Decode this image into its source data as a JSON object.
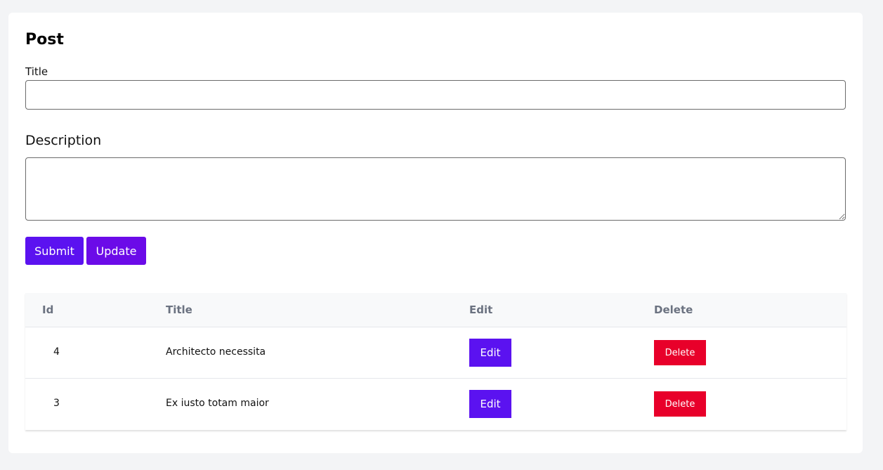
{
  "form": {
    "heading": "Post",
    "title_label": "Title",
    "title_value": "",
    "title_placeholder": "",
    "description_label": "Description",
    "description_value": "",
    "description_placeholder": "",
    "submit_label": "Submit",
    "update_label": "Update"
  },
  "table": {
    "columns": [
      "Id",
      "Title",
      "Edit",
      "Delete"
    ],
    "rows": [
      {
        "id": "4",
        "title": "Architecto necessita",
        "edit_label": "Edit",
        "delete_label": "Delete"
      },
      {
        "id": "3",
        "title": "Ex iusto totam maior",
        "edit_label": "Edit",
        "delete_label": "Delete"
      }
    ]
  },
  "colors": {
    "background": "#f3f4f6",
    "primary": "#5b12f0",
    "update": "#6b0be8",
    "danger": "#e8002a"
  }
}
